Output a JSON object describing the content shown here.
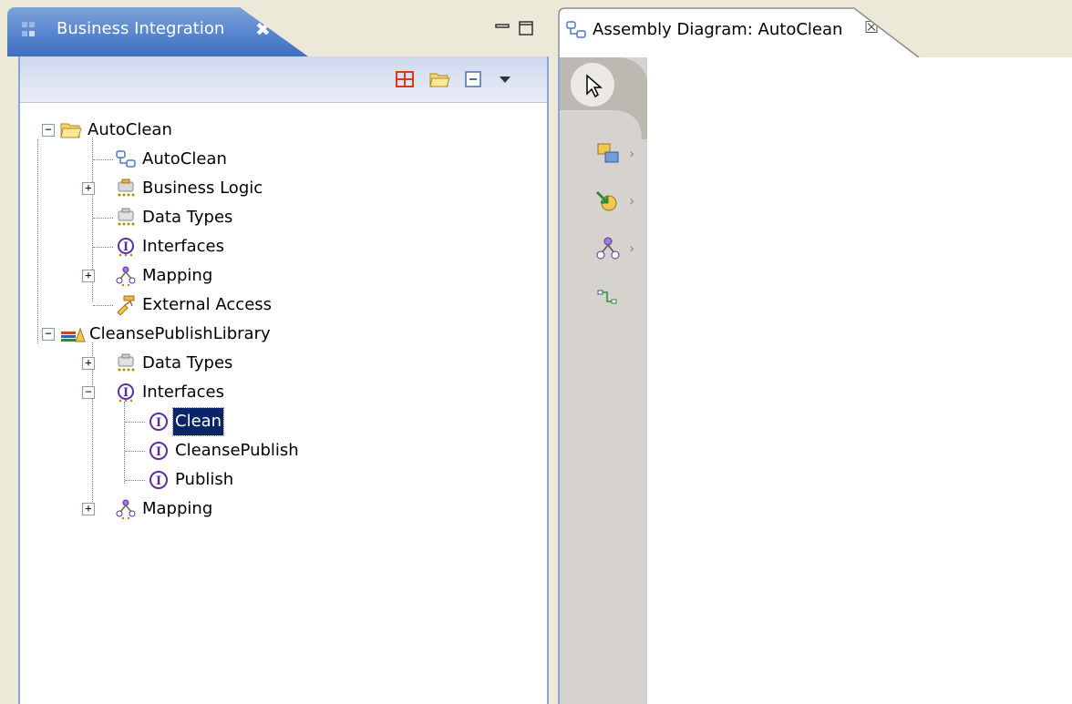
{
  "left_view": {
    "title": "Business Integration",
    "close_glyph": "✖",
    "toolbar": [
      "grid-icon",
      "open-folder-icon",
      "collapse-all-icon",
      "view-menu-icon"
    ]
  },
  "tree": {
    "autoclean": {
      "label": "AutoClean",
      "children": [
        "AutoClean",
        "Business Logic",
        "Data Types",
        "Interfaces",
        "Mapping",
        "External Access"
      ]
    },
    "library": {
      "label": "CleansePublishLibrary",
      "data_types": "Data Types",
      "interfaces": "Interfaces",
      "interface_children": [
        "Clean",
        "CleansePublish",
        "Publish"
      ],
      "mapping": "Mapping"
    },
    "selected": "Clean"
  },
  "editor": {
    "tab_label": "Assembly Diagram: AutoClean",
    "close_glyph": "☒"
  },
  "palette": {
    "items": [
      "select-pointer-icon",
      "components-icon",
      "imports-exports-icon",
      "mapping-components-icon",
      "wire-icon"
    ],
    "arrow_glyph": "›"
  },
  "colors": {
    "active_tab_blue": "#3e6fc0",
    "selection": "#0a246a",
    "interface_purple": "#5a2ea6",
    "folder_yellow": "#f5d66b"
  }
}
